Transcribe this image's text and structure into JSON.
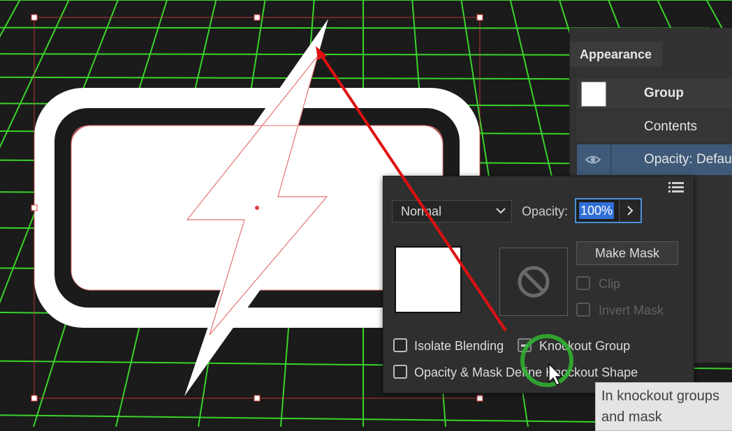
{
  "appearance": {
    "tab_label": "Appearance",
    "rows": [
      {
        "label": "Group",
        "swatch_color": "#ffffff"
      },
      {
        "label": "Contents"
      },
      {
        "label": "Opacity:  Default",
        "icon": "eye-icon"
      }
    ]
  },
  "transparency": {
    "blend_mode": "Normal",
    "opacity_label": "Opacity:",
    "opacity_value": "100%",
    "make_mask_label": "Make Mask",
    "clip_label": "Clip",
    "invert_mask_label": "Invert Mask",
    "isolate_blending_label": "Isolate Blending",
    "knockout_group_label": "Knockout Group",
    "opacity_mask_define_label": "Opacity & Mask Define Knockout Shape",
    "icons": [
      "panel-menu-icon",
      "chevron-down-icon",
      "chevron-right-icon",
      "no-mask-icon"
    ]
  },
  "tooltip": {
    "line1": "In knockout groups",
    "line2": "and mask"
  },
  "colors": {
    "grid": "#39d42a",
    "selection": "#e03c3c",
    "annotation_arrow": "#e01010",
    "click_highlight": "#2fb52f",
    "accent": "#2f6fd6"
  }
}
